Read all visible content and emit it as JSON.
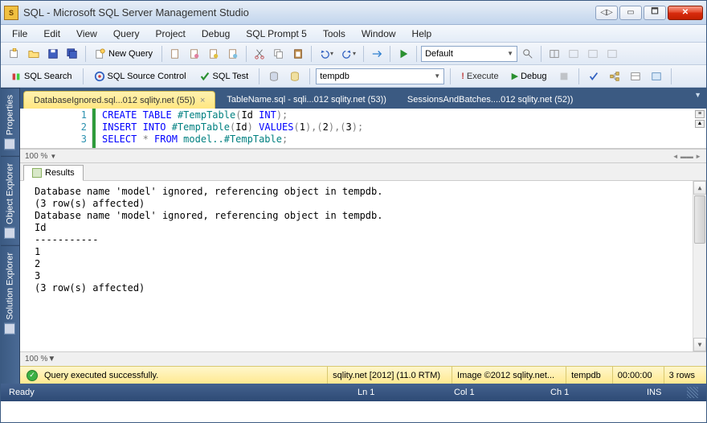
{
  "title": "SQL - Microsoft SQL Server Management Studio",
  "menu": [
    "File",
    "Edit",
    "View",
    "Query",
    "Project",
    "Debug",
    "SQL Prompt 5",
    "Tools",
    "Window",
    "Help"
  ],
  "toolbar1": {
    "newquery": "New Query",
    "combo_default": "Default"
  },
  "toolbar2": {
    "sqlsearch": "SQL Search",
    "sqlsource": "SQL Source Control",
    "sqltest": "SQL Test",
    "dbcombo": "tempdb",
    "execute": "Execute",
    "debug": "Debug"
  },
  "tabs": [
    "DatabaseIgnored.sql...012 sqlity.net (55))",
    "TableName.sql - sqli...012 sqlity.net (53))",
    "SessionsAndBatches....012 sqlity.net (52))"
  ],
  "sidetabs": [
    "Properties",
    "Object Explorer",
    "Solution Explorer"
  ],
  "code": {
    "lines": [
      1,
      2,
      3
    ],
    "l1": {
      "a": "CREATE",
      "b": " TABLE",
      "c": " #TempTable",
      "d": "(",
      "e": "Id ",
      "f": "INT",
      "g": ");"
    },
    "l2": {
      "a": "INSERT",
      "b": " INTO",
      "c": " #TempTable",
      "d": "(",
      "e": "Id",
      "f": ")",
      "g": " VALUES",
      "h": "(",
      "i": "1",
      "j": "),(",
      "k": "2",
      "l": "),(",
      "m": "3",
      "n": ");"
    },
    "l3": {
      "a": "SELECT",
      "b": " *",
      "c": " FROM",
      "d": " model..",
      "e": "#TempTable",
      "f": ";"
    }
  },
  "zoom": "100 %",
  "results_tab": "Results",
  "results_lines": [
    "Database name 'model' ignored, referencing object in tempdb.",
    "",
    "(3 row(s) affected)",
    "Database name 'model' ignored, referencing object in tempdb.",
    "Id",
    "-----------",
    "1",
    "2",
    "3",
    "",
    "(3 row(s) affected)"
  ],
  "status_yellow": {
    "msg": "Query executed successfully.",
    "server": "sqlity.net [2012] (11.0 RTM)",
    "image": "Image ©2012 sqlity.net...",
    "db": "tempdb",
    "time": "00:00:00",
    "rows": "3 rows"
  },
  "status_blue": {
    "ready": "Ready",
    "ln": "Ln 1",
    "col": "Col 1",
    "ch": "Ch 1",
    "ins": "INS"
  }
}
